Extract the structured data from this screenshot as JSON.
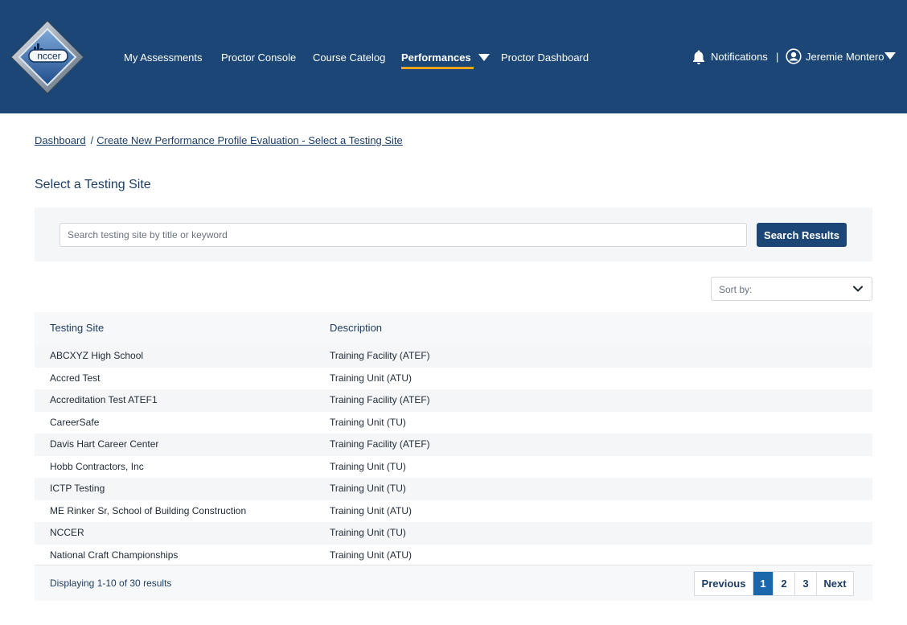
{
  "header": {
    "logo_text": "nccer",
    "nav": [
      {
        "label": "My Assessments"
      },
      {
        "label": "Proctor Console"
      },
      {
        "label": "Course Catelog"
      },
      {
        "label": "Performances"
      },
      {
        "label": "Proctor Dashboard"
      }
    ],
    "notifications_label": "Notifications",
    "separator": "|",
    "user_name": "Jeremie Montero",
    "accent_color": "#f2a51a",
    "bar_color": "#1b4676"
  },
  "breadcrumb": {
    "home": "Dashboard",
    "separator": "/",
    "current": "Create New Performance Profile Evaluation - Select a Testing Site"
  },
  "page": {
    "title": "Select a Testing Site"
  },
  "search": {
    "placeholder": "Search testing site by title or keyword",
    "value": "",
    "button_label": "Search Results"
  },
  "sort": {
    "label": "Sort by:"
  },
  "table": {
    "headers": [
      "Testing Site",
      "Description"
    ],
    "rows": [
      {
        "site": "ABCXYZ High School",
        "desc": "Training Facility (ATEF)"
      },
      {
        "site": "Accred Test",
        "desc": "Training Unit (ATU)"
      },
      {
        "site": "Accreditation Test ATEF1",
        "desc": "Training Facility (ATEF)"
      },
      {
        "site": "CareerSafe",
        "desc": "Training Unit (TU)"
      },
      {
        "site": "Davis Hart Career Center",
        "desc": "Training Facility (ATEF)"
      },
      {
        "site": "Hobb Contractors, Inc",
        "desc": "Training Unit (TU)"
      },
      {
        "site": "ICTP Testing",
        "desc": "Training Unit (TU)"
      },
      {
        "site": "ME Rinker Sr, School of Building Construction",
        "desc": "Training Unit (ATU)"
      },
      {
        "site": "NCCER",
        "desc": "Training Unit (TU)"
      },
      {
        "site": "National Craft Championships",
        "desc": "Training Unit (ATU)"
      }
    ]
  },
  "pagination": {
    "summary": "Displaying 1-10 of 30 results",
    "prev_label": "Previous",
    "pages": [
      "1",
      "2",
      "3"
    ],
    "active_page": "1",
    "next_label": "Next"
  }
}
